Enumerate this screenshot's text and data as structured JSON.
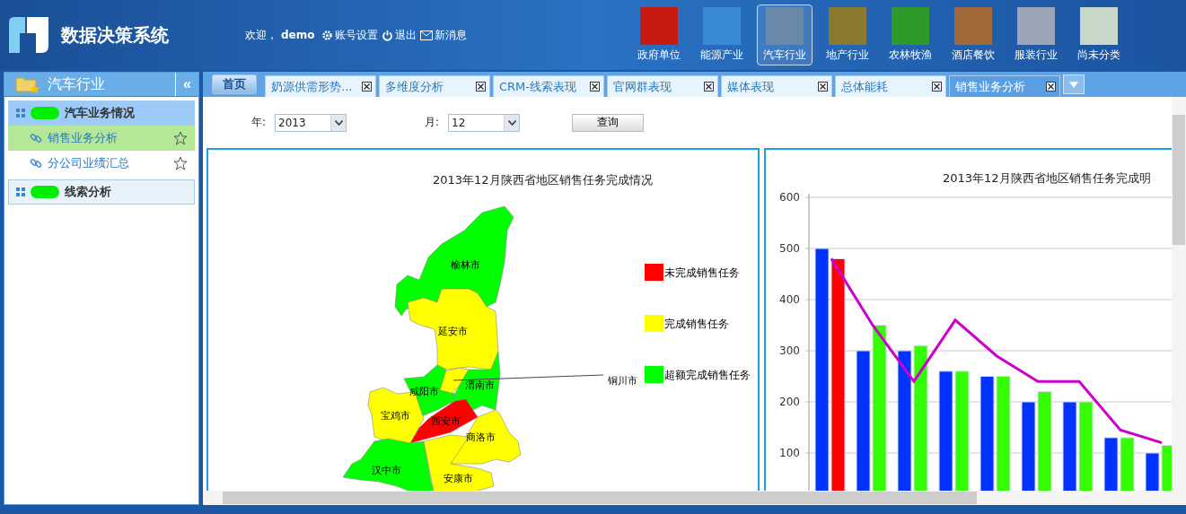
{
  "app": {
    "title": "数据决策系统"
  },
  "user_bar": [
    {
      "kind": "text",
      "label": "欢迎，"
    },
    {
      "kind": "user",
      "label": "demo"
    },
    {
      "kind": "settings",
      "label": "账号设置"
    },
    {
      "kind": "logout",
      "label": "退出"
    },
    {
      "kind": "mail",
      "label": "新消息"
    }
  ],
  "categories": [
    {
      "label": "政府单位",
      "selected": false
    },
    {
      "label": "能源产业",
      "selected": false
    },
    {
      "label": "汽车行业",
      "selected": true
    },
    {
      "label": "地产行业",
      "selected": false
    },
    {
      "label": "农林牧渔",
      "selected": false
    },
    {
      "label": "酒店餐饮",
      "selected": false
    },
    {
      "label": "服装行业",
      "selected": false
    },
    {
      "label": "尚未分类",
      "selected": false
    }
  ],
  "sidebar": {
    "title": "汽车行业",
    "collapse": "«",
    "groups": [
      {
        "label": "汽车业务情况",
        "expanded": true,
        "children": [
          {
            "label": "销售业务分析",
            "selected": true
          },
          {
            "label": "分公司业绩汇总",
            "selected": false
          }
        ]
      },
      {
        "label": "线索分析",
        "expanded": false
      }
    ]
  },
  "home_tab": "首页",
  "tabs": [
    {
      "label": "奶源供需形势...",
      "selected": false
    },
    {
      "label": "多维度分析",
      "selected": false
    },
    {
      "label": "CRM-线索表现",
      "selected": false
    },
    {
      "label": "官网群表现",
      "selected": false
    },
    {
      "label": "媒体表现",
      "selected": false
    },
    {
      "label": "总体能耗",
      "selected": false
    },
    {
      "label": "销售业务分析",
      "selected": true
    }
  ],
  "filters": {
    "year_label": "年:",
    "year": "2013",
    "month_label": "月:",
    "month": "12",
    "query_button": "查询"
  },
  "map_panel": {
    "title": "2013年12月陕西省地区销售任务完成情况",
    "legend": [
      {
        "label": "未完成销售任务",
        "color": "#ff0000"
      },
      {
        "label": "完成销售任务",
        "color": "#ffff00"
      },
      {
        "label": "超额完成销售任务",
        "color": "#00ff00"
      }
    ],
    "regions": [
      {
        "name": "榆林市",
        "color": "#00ff00"
      },
      {
        "name": "延安市",
        "color": "#ffff00"
      },
      {
        "name": "铜川市",
        "color": "#ffff00"
      },
      {
        "name": "渭南市",
        "color": "#00ff00"
      },
      {
        "name": "咸阳市",
        "color": "#00ff00"
      },
      {
        "name": "宝鸡市",
        "color": "#ffff00"
      },
      {
        "name": "西安市",
        "color": "#ff0000"
      },
      {
        "name": "商洛市",
        "color": "#ffff00"
      },
      {
        "name": "汉中市",
        "color": "#00ff00"
      },
      {
        "name": "安康市",
        "color": "#ffff00"
      }
    ]
  },
  "chart_panel": {
    "chart_data": {
      "type": "bar",
      "title": "2013年12月陕西省地区销售任务完成明",
      "ylim": [
        0,
        600
      ],
      "yticks": [
        100,
        200,
        300,
        400,
        500,
        600
      ],
      "stacked": false,
      "grid": true,
      "series": [
        {
          "color": "#0033ff",
          "values": [
            500,
            300,
            300,
            260,
            250,
            200,
            200,
            130,
            100
          ]
        },
        {
          "color": "#ff0000",
          "values": [
            480,
            null,
            null,
            null,
            null,
            null,
            null,
            null,
            null
          ]
        },
        {
          "color": "#33ff00",
          "values": [
            null,
            350,
            310,
            260,
            250,
            220,
            200,
            130,
            115
          ]
        },
        {
          "color": "#cc00cc",
          "type": "line",
          "values": [
            480,
            350,
            240,
            360,
            290,
            240,
            240,
            145,
            120
          ]
        }
      ]
    }
  }
}
